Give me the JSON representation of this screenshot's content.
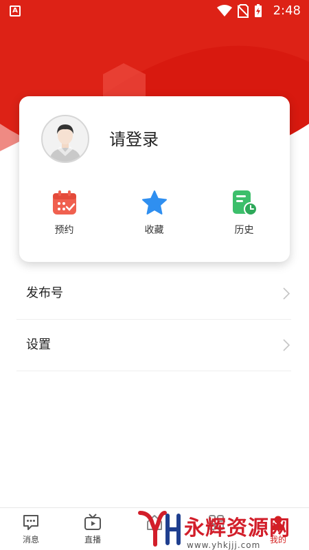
{
  "status_bar": {
    "time": "2:48",
    "app_badge": "A",
    "icons": [
      "wifi-icon",
      "no-sim-icon",
      "battery-charging-icon"
    ]
  },
  "profile": {
    "login_prompt": "请登录"
  },
  "quick_actions": [
    {
      "label": "预约",
      "icon": "calendar-icon",
      "color": "#f0604f"
    },
    {
      "label": "收藏",
      "icon": "star-icon",
      "color": "#2f8ff0"
    },
    {
      "label": "历史",
      "icon": "history-icon",
      "color": "#3cbf6b"
    }
  ],
  "menu": [
    {
      "label": "发布号"
    },
    {
      "label": "设置"
    }
  ],
  "bottom_nav": [
    {
      "label": "消息",
      "icon": "message-icon"
    },
    {
      "label": "直播",
      "icon": "tv-icon"
    },
    {
      "label": "",
      "icon": "home-icon"
    },
    {
      "label": "",
      "icon": "service-icon"
    },
    {
      "label": "我的",
      "icon": "user-icon",
      "active": true
    }
  ],
  "watermark": {
    "logo_text": "YH",
    "title": "永辉资源网",
    "url": "www.yhkjjj.com"
  },
  "colors": {
    "brand_red": "#d8190f",
    "active_tab": "#d4201f"
  }
}
